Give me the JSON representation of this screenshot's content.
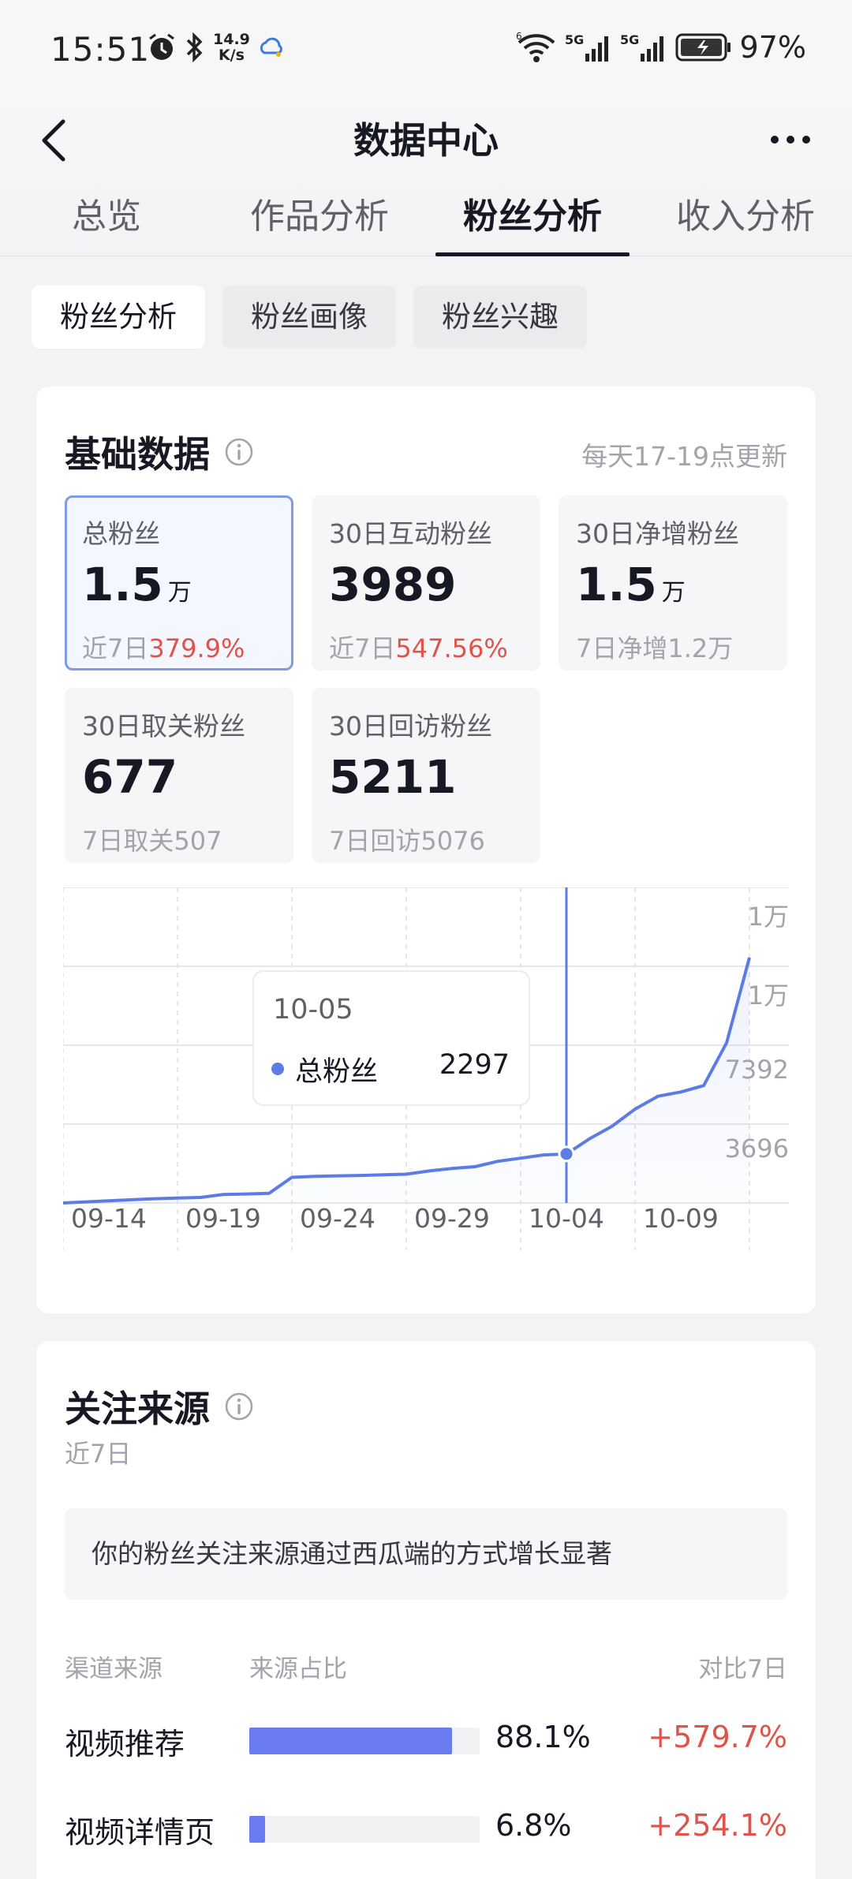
{
  "status_bar": {
    "time": "15:51",
    "net_speed_top": "14.9",
    "net_speed_bottom": "K/s",
    "battery": "97%",
    "icons": [
      "alarm-icon",
      "bluetooth-icon",
      "cloud-icon",
      "wifi-icon",
      "signal-5g-icon",
      "signal-5g-icon",
      "battery-charging-icon"
    ]
  },
  "header": {
    "title": "数据中心",
    "tabs": [
      {
        "label": "总览"
      },
      {
        "label": "作品分析"
      },
      {
        "label": "粉丝分析",
        "active": true
      },
      {
        "label": "收入分析"
      }
    ]
  },
  "subtabs": [
    {
      "label": "粉丝分析",
      "active": true
    },
    {
      "label": "粉丝画像"
    },
    {
      "label": "粉丝兴趣"
    }
  ],
  "basic": {
    "title": "基础数据",
    "update_note": "每天17-19点更新",
    "metrics": [
      {
        "label": "总粉丝",
        "value": "1.5",
        "unit": "万",
        "sub_prefix": "近7日",
        "sub_highlight": "379.9%",
        "selected": true
      },
      {
        "label": "30日互动粉丝",
        "value": "3989",
        "unit": "",
        "sub_prefix": "近7日",
        "sub_highlight": "547.56%"
      },
      {
        "label": "30日净增粉丝",
        "value": "1.5",
        "unit": "万",
        "sub_prefix": "7日净增1.2万",
        "sub_highlight": ""
      },
      {
        "label": "30日取关粉丝",
        "value": "677",
        "unit": "",
        "sub_prefix": "7日取关507",
        "sub_highlight": ""
      },
      {
        "label": "30日回访粉丝",
        "value": "5211",
        "unit": "",
        "sub_prefix": "7日回访5076",
        "sub_highlight": ""
      }
    ]
  },
  "chart_data": {
    "type": "area",
    "series": [
      {
        "name": "总粉丝",
        "color": "#5b7be6"
      }
    ],
    "x": [
      "09-12",
      "09-13",
      "09-14",
      "09-15",
      "09-16",
      "09-17",
      "09-18",
      "09-19",
      "09-20",
      "09-21",
      "09-22",
      "09-23",
      "09-24",
      "09-25",
      "09-26",
      "09-27",
      "09-28",
      "09-29",
      "09-30",
      "10-01",
      "10-02",
      "10-03",
      "10-04",
      "10-05",
      "10-06",
      "10-07",
      "10-08",
      "10-09",
      "10-10",
      "10-11",
      "10-12"
    ],
    "values": [
      0,
      50,
      100,
      150,
      200,
      230,
      260,
      400,
      420,
      450,
      1200,
      1250,
      1270,
      1290,
      1320,
      1350,
      1500,
      1620,
      1700,
      1950,
      2100,
      2250,
      2297,
      3000,
      3600,
      4400,
      5000,
      5200,
      5500,
      7500,
      11500
    ],
    "x_ticks": [
      "09-14",
      "09-19",
      "09-24",
      "09-29",
      "10-04",
      "10-09"
    ],
    "y_ticks": [
      "3696",
      "7392",
      "1万",
      "1万"
    ],
    "ylim": [
      0,
      14784
    ],
    "grid": true,
    "tooltip": {
      "date": "10-05",
      "series": "总粉丝",
      "value": "2297"
    }
  },
  "source": {
    "title": "关注来源",
    "period": "近7日",
    "insight": "你的粉丝关注来源通过西瓜端的方式增长显著",
    "headers": {
      "channel": "渠道来源",
      "share": "来源占比",
      "compare": "对比7日"
    },
    "rows": [
      {
        "channel": "视频推荐",
        "share_pct": "88.1%",
        "share": 0.881,
        "compare": "+579.7%"
      },
      {
        "channel": "视频详情页",
        "share_pct": "6.8%",
        "share": 0.068,
        "compare": "+254.1%"
      }
    ]
  }
}
